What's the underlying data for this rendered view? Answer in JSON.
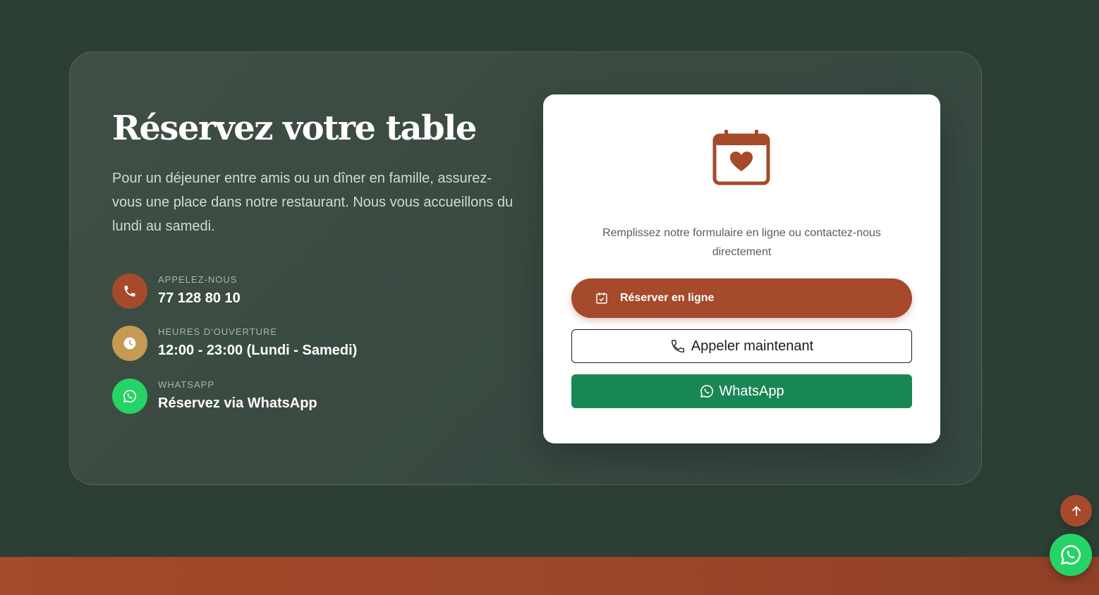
{
  "reservation": {
    "title": "Réservez votre table",
    "description": "Pour un déjeuner entre amis ou un dîner en famille, assurez-vous une place dans notre restaurant. Nous vous accueillons du lundi au samedi."
  },
  "contacts": [
    {
      "label": "APPELEZ-NOUS",
      "value": "77 128 80 10",
      "icon": "phone-icon",
      "color": "#a54a2a"
    },
    {
      "label": "HEURES D'OUVERTURE",
      "value": "12:00 - 23:00 (Lundi - Samedi)",
      "icon": "clock-icon",
      "color": "#c59a52"
    },
    {
      "label": "WHATSAPP",
      "value": "Réservez via WhatsApp",
      "icon": "whatsapp-icon",
      "color": "#25d366"
    }
  ],
  "card": {
    "icon": "calendar-heart-icon",
    "text": "Remplissez notre formulaire en ligne ou contactez-nous directement",
    "buttons": {
      "online": "Réserver en ligne",
      "call": "Appeler maintenant",
      "whatsapp": "WhatsApp"
    }
  },
  "floating": {
    "scroll_top_icon": "arrow-up-icon",
    "whatsapp_icon": "whatsapp-icon"
  },
  "colors": {
    "background": "#2d3e35",
    "accent": "#a54a2a",
    "gold": "#c59a52",
    "whatsapp_green": "#25d366",
    "button_green": "#198754"
  }
}
